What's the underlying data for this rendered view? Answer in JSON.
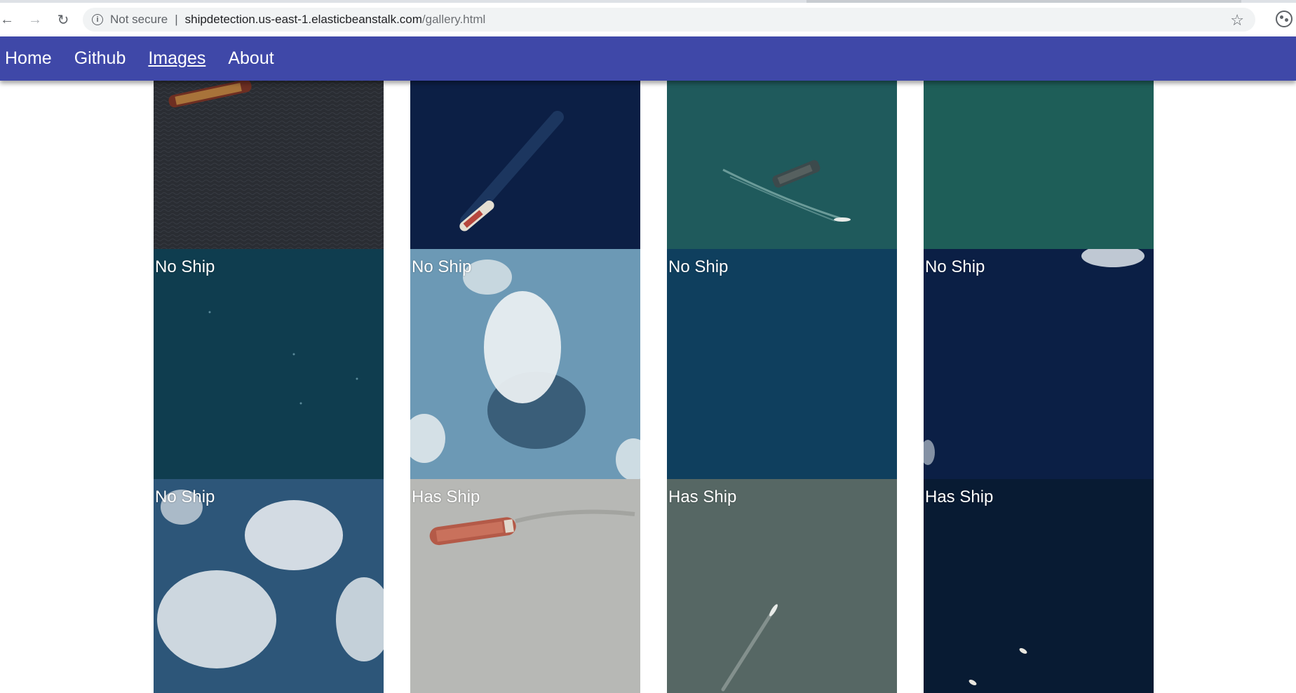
{
  "browser": {
    "security_label": "Not secure",
    "separator": "|",
    "url_host": "shipdetection.us-east-1.elasticbeanstalk.com",
    "url_path": "/gallery.html",
    "icons": [
      "back-arrow-icon",
      "forward-arrow-icon",
      "reload-icon",
      "info-icon",
      "star-icon",
      "extension-icon"
    ]
  },
  "nav": {
    "items": [
      {
        "label": "Home"
      },
      {
        "label": "Github"
      },
      {
        "label": "Images",
        "active": true
      },
      {
        "label": "About"
      }
    ]
  },
  "colors": {
    "nav_bar": "#3f48a8",
    "tile_1": "#2a2d33",
    "tile_2": "#0c1f45",
    "tile_3": "#1f5a5c",
    "tile_4": "#1e5e58",
    "tile_5": "#0f3d4f",
    "tile_6": "#6c99b5",
    "tile_7": "#0f3f5e",
    "tile_8": "#0b1f45",
    "tile_9": "#2d5679",
    "tile_10": "#b7b8b5",
    "tile_11": "#566764",
    "tile_12": "#081b33"
  },
  "gallery": {
    "rows": [
      {
        "tiles": [
          {
            "label": ""
          },
          {
            "label": ""
          },
          {
            "label": ""
          },
          {
            "label": ""
          }
        ]
      },
      {
        "tiles": [
          {
            "label": "No Ship"
          },
          {
            "label": "No Ship"
          },
          {
            "label": "No Ship"
          },
          {
            "label": "No Ship"
          }
        ]
      },
      {
        "tiles": [
          {
            "label": "No Ship"
          },
          {
            "label": "Has Ship"
          },
          {
            "label": "Has Ship"
          },
          {
            "label": "Has Ship"
          }
        ]
      }
    ]
  }
}
